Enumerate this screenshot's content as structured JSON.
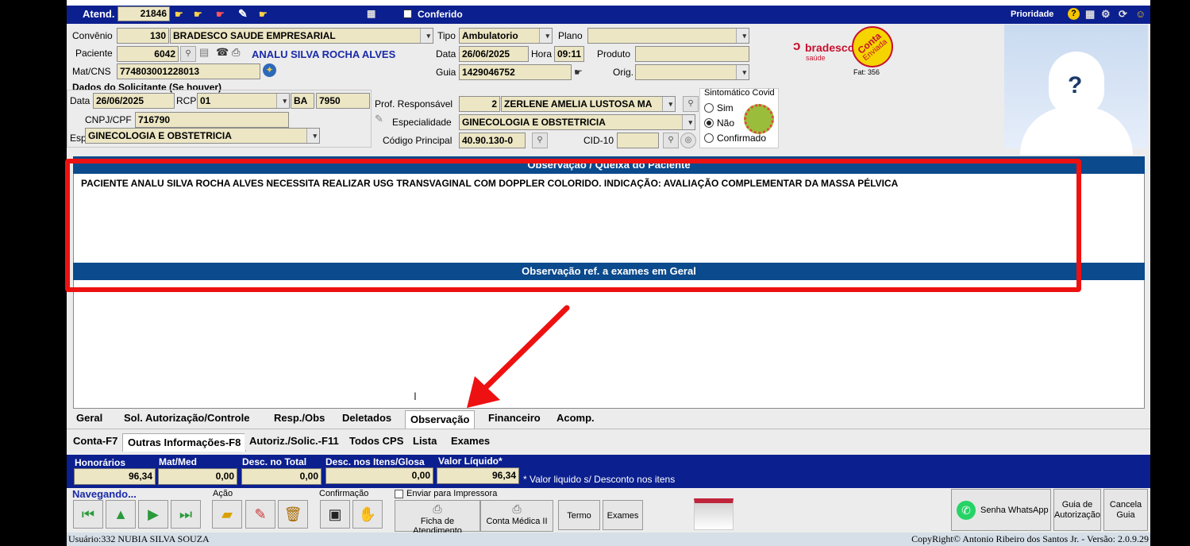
{
  "top": {
    "atend_label": "Atend.",
    "atend_value": "21846",
    "conferido_label": "Conferido",
    "prioridade_label": "Prioridade"
  },
  "form": {
    "convenio_label": "Convênio",
    "convenio_code": "130",
    "convenio_name": "BRADESCO SAUDE EMPRESARIAL",
    "tipo_label": "Tipo",
    "tipo_value": "Ambulatorio",
    "plano_label": "Plano",
    "plano_value": "",
    "paciente_label": "Paciente",
    "paciente_code": "6042",
    "paciente_name": "ANALU SILVA ROCHA ALVES",
    "data_label": "Data",
    "data_value": "26/06/2025",
    "hora_label": "Hora",
    "hora_value": "09:11",
    "produto_label": "Produto",
    "produto_value": "",
    "matcns_label": "Mat/CNS",
    "matcns_value": "774803001228013",
    "guia_label": "Guia",
    "guia_value": "1429046752",
    "orig_label": "Orig.",
    "orig_value": ""
  },
  "solicitante": {
    "title": "Dados do Solicitante (Se houver)",
    "data_label": "Data",
    "data_value": "26/06/2025",
    "rcp_label": "RCP",
    "rcp_value": "01",
    "uf_value": "BA",
    "num_value": "7950",
    "cnpj_label": "CNPJ/CPF",
    "cnpj_value": "716790",
    "esp_label": "Esp",
    "esp_value": "GINECOLOGIA E OBSTETRICIA"
  },
  "prof": {
    "prof_label": "Prof. Responsável",
    "prof_code": "2",
    "prof_name": "ZERLENE AMELIA LUSTOSA MA",
    "esp_label": "Especialidade",
    "esp_value": "GINECOLOGIA E OBSTETRICIA",
    "codigo_label": "Código Principal",
    "codigo_value": "40.90.130-0",
    "cid_label": "CID-10",
    "cid_value": ""
  },
  "covid": {
    "title": "Sintomático Covid",
    "options": [
      "Sim",
      "Não",
      "Confirmado"
    ],
    "selected": "Não"
  },
  "logo": {
    "brand": "bradesco",
    "brand_sub": "saúde",
    "stamp_line1": "Conta",
    "stamp_line2": "Enviada",
    "fat_text": "Fat: 356"
  },
  "obs": {
    "header1": "Observação / Queixa do Paciente",
    "text": "PACIENTE ANALU SILVA ROCHA ALVES NECESSITA REALIZAR USG TRANSVAGINAL COM DOPPLER COLORIDO. INDICAÇÃO: AVALIAÇÃO COMPLEMENTAR DA MASSA PÉLVICA",
    "header2": "Observação ref. a exames em Geral"
  },
  "tabs1": [
    "Geral",
    "Sol. Autorização/Controle",
    "Resp./Obs",
    "Deletados",
    "Observação",
    "Financeiro",
    "Acomp."
  ],
  "tabs2": [
    "Conta-F7",
    "Outras Informações-F8",
    "Autoriz./Solic.-F11",
    "Todos CPS",
    "Lista",
    "Exames"
  ],
  "totals": {
    "honorarios_label": "Honorários",
    "honorarios_value": "96,34",
    "matmed_label": "Mat/Med",
    "matmed_value": "0,00",
    "desc_total_label": "Desc. no Total",
    "desc_total_value": "0,00",
    "desc_itens_label": "Desc. nos Itens/Glosa",
    "desc_itens_value": "0,00",
    "liquido_label": "Valor Líquido*",
    "liquido_value": "96,34",
    "note": "* Valor liquido s/ Desconto nos itens"
  },
  "bottom": {
    "nav_label": "Navegando...",
    "acao_label": "Ação",
    "confirmacao_label": "Confirmação",
    "enviar_label": "Enviar para Impressora",
    "ficha_label": "Ficha de Atendimento",
    "conta_label": "Conta Médica II",
    "termo_label": "Termo",
    "exames_label": "Exames",
    "whatsapp_label": "Senha WhatsApp",
    "guia_aut_label": "Guia de Autorização",
    "cancela_label": "Cancela Guia"
  },
  "status": {
    "usuario": "Usuário:332 NUBIA SILVA SOUZA",
    "copyright": "CopyRight© Antonio Ribeiro dos Santos Jr. - Versão: 2.0.9.29"
  },
  "colors": {
    "title_blue": "#0b1f8f",
    "header_blue": "#0b4a8c",
    "field_bg": "#ece6c4",
    "annotation_red": "#ee1111"
  }
}
